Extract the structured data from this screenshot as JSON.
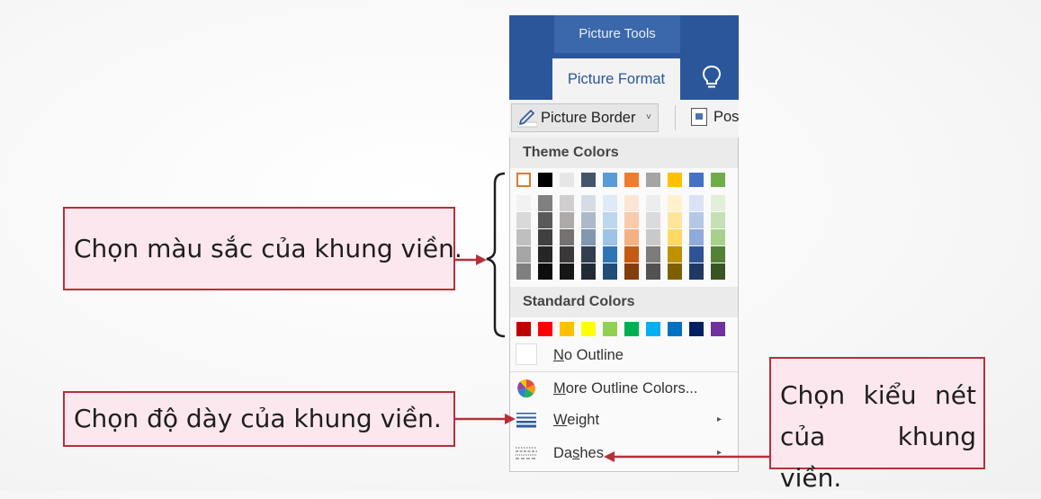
{
  "ribbon": {
    "context_label": "Picture Tools",
    "active_tab": "Picture Format",
    "tell_me_icon": "lightbulb-icon",
    "picture_border_label": "Picture Border",
    "picture_border_caret": "˅",
    "position_label": "Pos"
  },
  "menu": {
    "theme_colors_heading": "Theme Colors",
    "standard_colors_heading": "Standard Colors",
    "theme_base_colors": [
      "#ffffff",
      "#000000",
      "#e7e6e6",
      "#44546a",
      "#5b9bd5",
      "#ed7d31",
      "#a5a5a5",
      "#ffc000",
      "#4472c4",
      "#70ad47"
    ],
    "theme_shades": [
      [
        "#f2f2f2",
        "#d9d9d9",
        "#bfbfbf",
        "#a6a6a6",
        "#808080"
      ],
      [
        "#808080",
        "#595959",
        "#404040",
        "#262626",
        "#0d0d0d"
      ],
      [
        "#d0cece",
        "#aeaaaa",
        "#757171",
        "#3a3838",
        "#171616"
      ],
      [
        "#d6dce4",
        "#adb9ca",
        "#8497b0",
        "#333f4f",
        "#222a35"
      ],
      [
        "#deebf6",
        "#bdd7ee",
        "#9dc3e6",
        "#2e75b5",
        "#1f4e79"
      ],
      [
        "#fbe5d5",
        "#f8cbad",
        "#f4b183",
        "#c55a11",
        "#833c0b"
      ],
      [
        "#ededed",
        "#dbdbdb",
        "#c9c9c9",
        "#7b7b7b",
        "#525252"
      ],
      [
        "#fff2cc",
        "#fee599",
        "#ffd965",
        "#bf9000",
        "#7f6000"
      ],
      [
        "#dae3f3",
        "#b4c7e7",
        "#8faadc",
        "#2f5496",
        "#1f3864"
      ],
      [
        "#e2efd9",
        "#c5e0b3",
        "#a8d08d",
        "#538135",
        "#375623"
      ]
    ],
    "standard_colors": [
      "#c00000",
      "#ff0000",
      "#ffc000",
      "#ffff00",
      "#92d050",
      "#00b050",
      "#00b0f0",
      "#0070c0",
      "#002060",
      "#7030a0"
    ],
    "no_outline_label": "No Outline",
    "more_colors_label": "More Outline Colors...",
    "weight_label": "Weight",
    "dashes_label": "Dashes",
    "submenu_arrow": "▸"
  },
  "callouts": {
    "color_note": "Chọn màu sắc của khung viền.",
    "weight_note": "Chọn độ dày của khung viền.",
    "dash_note_line1": "Chọn kiểu nét",
    "dash_note_line2": "của khung viền."
  }
}
